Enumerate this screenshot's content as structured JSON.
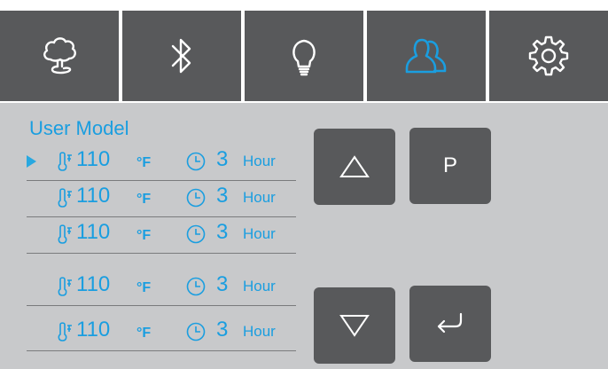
{
  "tabs": [
    {
      "icon": "tree-cloud-icon",
      "active": false
    },
    {
      "icon": "bluetooth-icon",
      "active": false
    },
    {
      "icon": "light-bulb-icon",
      "active": false
    },
    {
      "icon": "user-profile-icon",
      "active": true
    },
    {
      "icon": "gear-icon",
      "active": false
    }
  ],
  "colors": {
    "accent": "#1a9ee0",
    "tab_bg": "#58595b",
    "panel_bg": "#c8c9cb",
    "button_bg": "#58595b"
  },
  "user_model": {
    "title": "User Model",
    "selected_index": 0,
    "rows": [
      {
        "temperature": "110",
        "temp_unit": "°F",
        "time": "3",
        "time_unit": "Hour"
      },
      {
        "temperature": "110",
        "temp_unit": "°F",
        "time": "3",
        "time_unit": "Hour"
      },
      {
        "temperature": "110",
        "temp_unit": "°F",
        "time": "3",
        "time_unit": "Hour"
      },
      {
        "temperature": "110",
        "temp_unit": "°F",
        "time": "3",
        "time_unit": "Hour"
      },
      {
        "temperature": "110",
        "temp_unit": "°F",
        "time": "3",
        "time_unit": "Hour"
      }
    ]
  },
  "buttons": {
    "up_icon": "triangle-up-icon",
    "program_label": "P",
    "down_icon": "triangle-down-icon",
    "back_icon": "return-arrow-icon"
  }
}
